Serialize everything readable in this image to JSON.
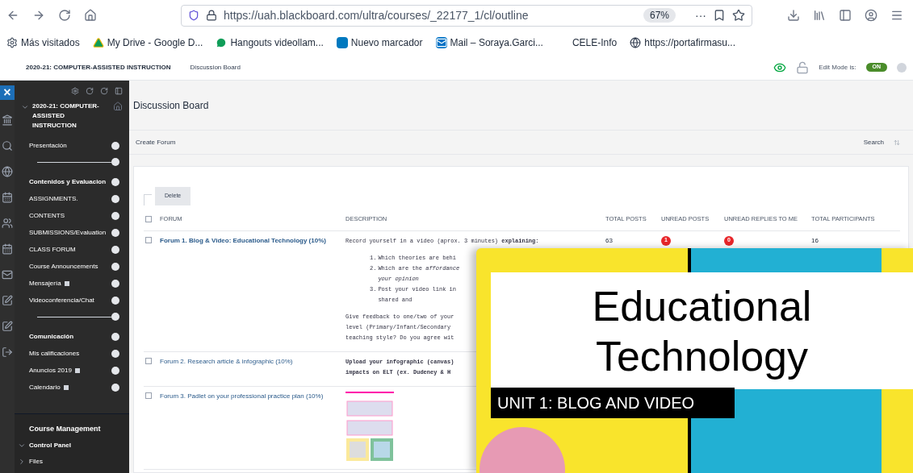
{
  "browser": {
    "url": "https://uah.blackboard.com/ultra/courses/_22177_1/cl/outline",
    "zoom": "67%",
    "more": "···",
    "bookmarks": [
      {
        "kind": "gear",
        "label": "Más visitados"
      },
      {
        "kind": "drive",
        "label": "My Drive - Google D..."
      },
      {
        "kind": "chat",
        "label": "Hangouts videollam..."
      },
      {
        "kind": "board",
        "label": "Nuevo marcador"
      },
      {
        "kind": "mail",
        "label": "Mail – Soraya.Garci..."
      },
      {
        "kind": "plain",
        "label": "CELE-Info"
      },
      {
        "kind": "globe",
        "label": "https://portafirmasu..."
      }
    ]
  },
  "header": {
    "course": "2020-21: COMPUTER-ASSISTED INSTRUCTION",
    "breadcrumb": "Discussion Board",
    "edit_mode_label": "Edit Mode is:",
    "edit_mode": {
      "label": "ON",
      "on": true
    }
  },
  "sidebar": {
    "close": "×",
    "course": "2020-21: COMPUTER-ASSISTED INSTRUCTION",
    "items": [
      {
        "kind": "link",
        "label": "Presentación",
        "bold": false,
        "badge": false
      },
      {
        "kind": "divider"
      },
      {
        "kind": "link",
        "label": "Contenidos y Evaluacion",
        "bold": true,
        "badge": false
      },
      {
        "kind": "link",
        "label": "ASSIGNMENTS.",
        "bold": false,
        "badge": false
      },
      {
        "kind": "link",
        "label": "CONTENTS",
        "bold": false,
        "badge": false
      },
      {
        "kind": "link",
        "label": "SUBMISSIONS/Evaluation",
        "bold": false,
        "badge": false
      },
      {
        "kind": "link",
        "label": "CLASS FORUM",
        "bold": false,
        "badge": false
      },
      {
        "kind": "link",
        "label": "Course Announcements",
        "bold": false,
        "badge": false
      },
      {
        "kind": "link",
        "label": "Mensajería",
        "bold": false,
        "badge": true
      },
      {
        "kind": "link",
        "label": "Videoconferencia/Chat",
        "bold": false,
        "badge": false
      },
      {
        "kind": "divider"
      },
      {
        "kind": "link",
        "label": "Comunicación",
        "bold": true,
        "badge": false
      },
      {
        "kind": "link",
        "label": "Mis calificaciones",
        "bold": false,
        "badge": false
      },
      {
        "kind": "link",
        "label": "Anuncios 2019",
        "bold": false,
        "badge": true
      },
      {
        "kind": "link",
        "label": "Calendario",
        "bold": false,
        "badge": true
      }
    ],
    "management": "Course Management",
    "panel": [
      {
        "label": "Control Panel",
        "expanded": true
      },
      {
        "label": "Files",
        "expanded": false
      }
    ]
  },
  "page": {
    "title": "Discussion Board",
    "create": "Create Forum",
    "search": "Search"
  },
  "table": {
    "delete": "Delete",
    "select_all_checked": false,
    "columns": [
      "FORUM",
      "DESCRIPTION",
      "TOTAL POSTS",
      "UNREAD POSTS",
      "UNREAD REPLIES TO ME",
      "TOTAL PARTICIPANTS"
    ],
    "rows": [
      {
        "title": "Forum 1. Blog & Video: Educational Technology (10%)",
        "bold": true,
        "checked": false,
        "description": [
          {
            "kind": "text",
            "lines": [
              "Record yourself in a video (aprox. 3 minutes) **explaining:**"
            ]
          },
          {
            "kind": "list",
            "items": [
              {
                "n": "1.",
                "lines": [
                  "Which theories are behi"
                ]
              },
              {
                "n": "2.",
                "lines": [
                  "Which are the *affordance*",
                  "*your opinion*"
                ]
              },
              {
                "n": "3.",
                "lines": [
                  "Post your video link in",
                  "shared and"
                ]
              }
            ]
          },
          {
            "kind": "text",
            "lines": [
              "Give feedback to one/two of your",
              "level (Primary/Infant/Secondary",
              "teaching style? Do you agree wit"
            ]
          }
        ],
        "total": "63",
        "unread": "1",
        "replies": "0",
        "participants": "16"
      },
      {
        "title": "Forum 2. Research article & infographic (10%)",
        "bold": false,
        "checked": false,
        "description": [
          {
            "kind": "text",
            "lines": [
              "**Upload your infographic (canvas)**",
              "**impacts on ELT (ex. Dudeney & H**"
            ]
          }
        ]
      },
      {
        "title": "Forum 3. Padlet on your professional practice plan (10%)",
        "bold": false,
        "checked": false,
        "description": [
          {
            "kind": "image"
          }
        ]
      }
    ]
  },
  "slide": {
    "title": [
      "Educational",
      "Technology"
    ],
    "subtitle": "UNIT 1: BLOG AND VIDEO"
  }
}
